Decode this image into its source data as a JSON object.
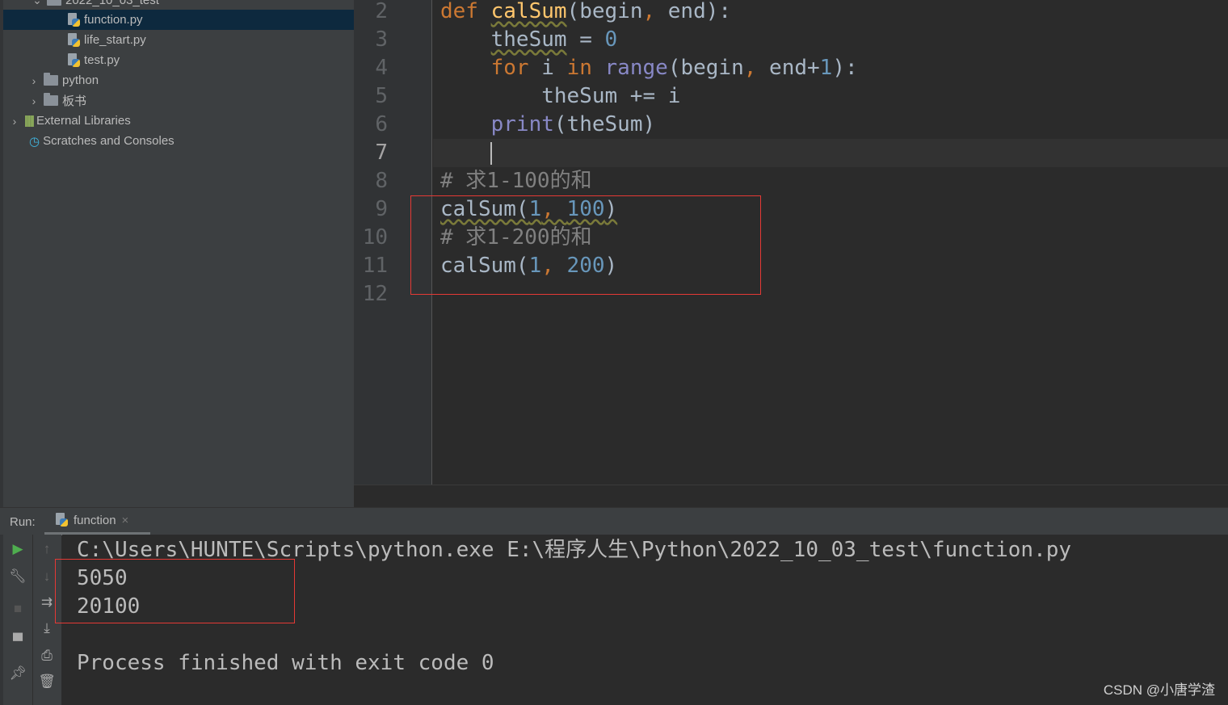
{
  "project_tree": {
    "folder_partial": "2022_10_03_test",
    "files": [
      "function.py",
      "life_start.py",
      "test.py"
    ],
    "selected": "function.py",
    "folders": [
      "python",
      "板书"
    ],
    "external_libraries": "External Libraries",
    "scratches": "Scratches and Consoles"
  },
  "editor": {
    "current_line": 7,
    "lines": [
      {
        "n": "2",
        "tokens": [
          [
            "kw",
            "def "
          ],
          [
            "fn wavy",
            "calSum"
          ],
          [
            "tx",
            "(begin"
          ],
          [
            "kw",
            ", "
          ],
          [
            "tx",
            "end):"
          ]
        ]
      },
      {
        "n": "3",
        "tokens": [
          [
            "tx",
            "    "
          ],
          [
            "tx wavy",
            "theSum"
          ],
          [
            "tx",
            " = "
          ],
          [
            "num",
            "0"
          ]
        ]
      },
      {
        "n": "4",
        "tokens": [
          [
            "tx",
            "    "
          ],
          [
            "kw",
            "for "
          ],
          [
            "tx",
            "i "
          ],
          [
            "kw",
            "in "
          ],
          [
            "bi",
            "range"
          ],
          [
            "tx",
            "(begin"
          ],
          [
            "kw",
            ", "
          ],
          [
            "tx",
            "end+"
          ],
          [
            "num",
            "1"
          ],
          [
            "tx",
            "):"
          ]
        ]
      },
      {
        "n": "5",
        "tokens": [
          [
            "tx",
            "        theSum += i"
          ]
        ]
      },
      {
        "n": "6",
        "tokens": [
          [
            "tx",
            "    "
          ],
          [
            "bi",
            "print"
          ],
          [
            "tx",
            "(theSum)"
          ]
        ]
      },
      {
        "n": "7",
        "tokens": []
      },
      {
        "n": "8",
        "tokens": [
          [
            "cm",
            "# 求1-100的和"
          ]
        ]
      },
      {
        "n": "9",
        "tokens": [
          [
            "tx wavy",
            "calSum("
          ],
          [
            "num wavy",
            "1"
          ],
          [
            "kw wavy",
            ", "
          ],
          [
            "num wavy",
            "100"
          ],
          [
            "tx wavy",
            ")"
          ]
        ]
      },
      {
        "n": "10",
        "tokens": [
          [
            "cm",
            "# 求1-200的和"
          ]
        ]
      },
      {
        "n": "11",
        "tokens": [
          [
            "tx",
            "calSum("
          ],
          [
            "num",
            "1"
          ],
          [
            "kw",
            ", "
          ],
          [
            "num",
            "200"
          ],
          [
            "tx",
            ")"
          ]
        ]
      },
      {
        "n": "12",
        "tokens": []
      }
    ]
  },
  "run": {
    "label": "Run:",
    "tab": "function",
    "close": "×",
    "output": [
      "C:\\Users\\HUNTE\\Scripts\\python.exe E:\\程序人生\\Python\\2022_10_03_test\\function.py",
      "5050",
      "20100",
      "",
      "Process finished with exit code 0"
    ]
  },
  "colors": {
    "keyword": "#cc7832",
    "function": "#ffc66d",
    "builtin": "#8888c6",
    "number": "#6897bb",
    "comment": "#808080",
    "highlight_box": "#e53935"
  },
  "watermark": "CSDN @小唐学渣"
}
